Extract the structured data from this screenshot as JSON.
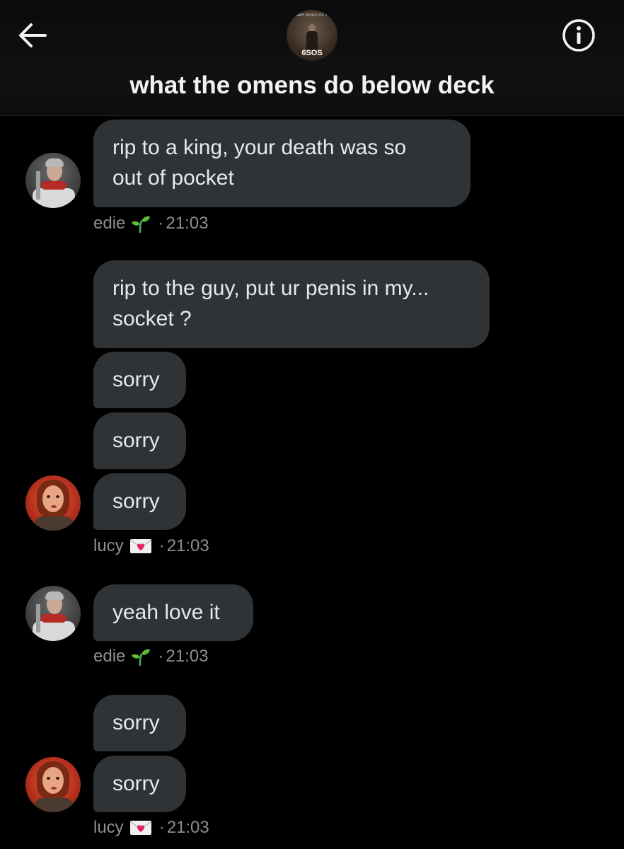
{
  "header": {
    "title": "what the omens do below deck",
    "group_avatar_label": "6SOS",
    "group_avatar_small_text": "AAH WORD OF T",
    "back_icon": "arrow-left-icon",
    "info_icon": "info-circle-icon"
  },
  "messages": [
    {
      "text_line1": "rip to a king, your death was so",
      "text_line2": "out of pocket"
    },
    {
      "text_line1": "rip to the guy, put ur penis in my...",
      "text_line2": "socket ?"
    },
    {
      "text": "sorry"
    },
    {
      "text": "sorry"
    },
    {
      "text": "sorry"
    },
    {
      "text": "yeah love it"
    },
    {
      "text": "sorry"
    },
    {
      "text": "sorry"
    }
  ],
  "meta": [
    {
      "sender": "edie",
      "emoji": "seedling-icon",
      "dot": "·",
      "time": "21:03"
    },
    {
      "sender": "lucy",
      "emoji": "love-letter-icon",
      "dot": "·",
      "time": "21:03"
    },
    {
      "sender": "edie",
      "emoji": "seedling-icon",
      "dot": "·",
      "time": "21:03"
    },
    {
      "sender": "lucy",
      "emoji": "love-letter-icon",
      "dot": "·",
      "time": "21:03"
    }
  ],
  "colors": {
    "background": "#000000",
    "bubble": "#2f3336",
    "text": "#e7e9ea",
    "meta_text": "#8b8f93"
  }
}
